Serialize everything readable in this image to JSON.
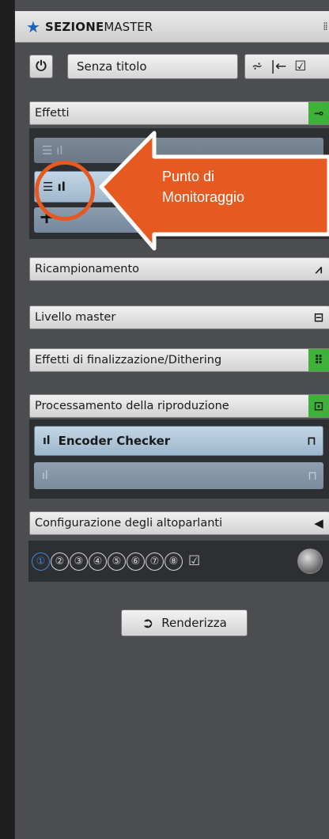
{
  "window": {
    "title_bold": "SEZIONE",
    "title_regular": "MASTER",
    "star_icon": "star-icon",
    "grip_icon": "⁞⁞"
  },
  "preset": {
    "power_icon": "⏻",
    "name": "Senza titolo",
    "icons": [
      "⩫",
      "|←",
      "☑"
    ]
  },
  "effetti": {
    "label": "Effetti",
    "status_color": "#3fb03a",
    "slots": [
      {
        "icon": "☰ ıl",
        "label": ""
      },
      {
        "icon": "☰ ıl",
        "label": ""
      }
    ],
    "add_icon": "+"
  },
  "callout": {
    "text_line1": "Punto di",
    "text_line2": "Monitoraggio",
    "color": "#e65a22"
  },
  "sections": {
    "ricampionamento": {
      "label": "Ricampionamento",
      "icon": "⩘"
    },
    "livello_master": {
      "label": "Livello master",
      "icon": "⊟"
    },
    "finalizzazione": {
      "label": "Effetti di finalizzazione/Dithering",
      "icon": "⠿"
    },
    "riproduzione": {
      "label": "Processamento della riproduzione",
      "icon": "⊡"
    },
    "altoparlanti": {
      "label": "Configurazione degli altoparlanti",
      "icon": "◀"
    }
  },
  "riproduzione_slots": [
    {
      "icon": "ıl",
      "label": "Encoder Checker",
      "right_icon": "⊓"
    },
    {
      "icon": "ıl",
      "label": "",
      "right_icon": "⊓"
    }
  ],
  "speakers": {
    "channels": [
      "①",
      "②",
      "③",
      "④",
      "⑤",
      "⑥",
      "⑦",
      "⑧"
    ],
    "active_index": 0,
    "active_color": "#3b8ad9",
    "check_icon": "☑"
  },
  "render_button": {
    "icon": "➲",
    "label": "Renderizza"
  }
}
